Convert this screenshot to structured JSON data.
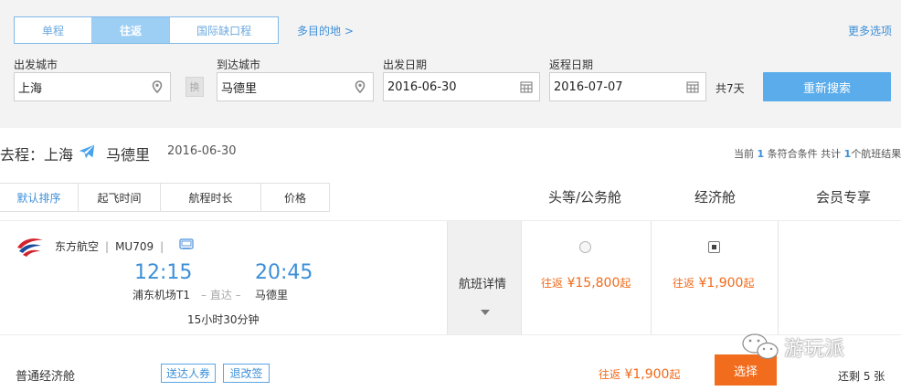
{
  "search": {
    "trip_tabs": [
      "单程",
      "往返",
      "国际缺口程"
    ],
    "active_tab": 1,
    "multi_destination_link": "多目的地 >",
    "more_options_link": "更多选项",
    "departure_city_label": "出发城市",
    "departure_city_value": "上海",
    "swap_label": "换",
    "arrival_city_label": "到达城市",
    "arrival_city_value": "马德里",
    "departure_date_label": "出发日期",
    "departure_date_value": "2016-06-30",
    "return_date_label": "返程日期",
    "return_date_value": "2016-07-07",
    "trip_length": "共7天",
    "search_button": "重新搜索"
  },
  "route": {
    "prefix": "去程：上海",
    "destination": "马德里",
    "date": "2016-06-30",
    "summary_before": "当前 ",
    "summary_count": "1",
    "summary_middle": " 条符合条件 共计 ",
    "summary_total": "1",
    "summary_after": "个航班结果"
  },
  "sort": {
    "buttons": [
      "默认排序",
      "起飞时间",
      "航程时长",
      "价格"
    ],
    "active": 0
  },
  "columns": [
    "头等/公务舱",
    "经济舱",
    "会员专享"
  ],
  "flight": {
    "airline": "东方航空",
    "flight_no": "MU709",
    "sep": "|",
    "depart_time": "12:15",
    "arrive_time": "20:45",
    "depart_airport": "浦东机场T1",
    "arrive_airport": "马德里",
    "direct": "– 直达 –",
    "duration": "15小时30分钟",
    "details_label": "航班详情",
    "first_class_fare": {
      "prefix": "往返",
      "price": "¥15,800",
      "suffix": "起"
    },
    "economy_fare": {
      "prefix": "往返",
      "price": "¥1,900",
      "suffix": "起"
    }
  },
  "cabin": {
    "name": "普通经济舱",
    "tag_delivery": "送达人券",
    "tag_change": "退改签",
    "fare": {
      "prefix": "往返",
      "price": "¥1,900",
      "suffix": "起"
    },
    "select_button": "选择",
    "remaining": "还剩 5 张"
  },
  "watermark": "游玩派",
  "colors": {
    "accent_blue": "#3d8fd8",
    "button_blue": "#5aacea",
    "price_orange": "#f16a1a",
    "select_orange": "#f26c1e"
  }
}
